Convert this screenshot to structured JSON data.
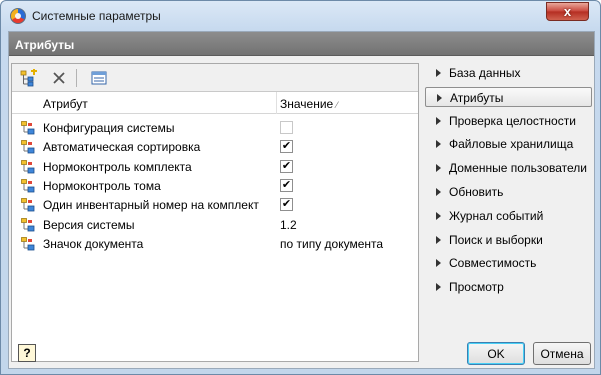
{
  "window": {
    "title": "Системные параметры",
    "close_glyph": "x"
  },
  "header": {
    "title": "Атрибуты"
  },
  "toolbar": {
    "buttons": [
      {
        "name": "add-attribute-icon"
      },
      {
        "name": "delete-icon"
      },
      {
        "name": "properties-icon"
      }
    ]
  },
  "grid": {
    "columns": {
      "attribute": "Атрибут",
      "value": "Значение"
    },
    "rows": [
      {
        "label": "Конфигурация системы",
        "type": "checkbox",
        "checked": false,
        "value": ""
      },
      {
        "label": "Автоматическая сортировка",
        "type": "checkbox",
        "checked": true,
        "value": ""
      },
      {
        "label": "Нормоконтроль комплекта",
        "type": "checkbox",
        "checked": true,
        "value": ""
      },
      {
        "label": "Нормоконтроль тома",
        "type": "checkbox",
        "checked": true,
        "value": ""
      },
      {
        "label": "Один инвентарный номер на комплект",
        "type": "checkbox",
        "checked": true,
        "value": ""
      },
      {
        "label": "Версия системы",
        "type": "text",
        "checked": false,
        "value": "1.2"
      },
      {
        "label": "Значок документа",
        "type": "text",
        "checked": false,
        "value": "по типу документа"
      }
    ]
  },
  "nav": {
    "items": [
      {
        "label": "База данных",
        "active": false
      },
      {
        "label": "Атрибуты",
        "active": true
      },
      {
        "label": "Проверка целостности",
        "active": false
      },
      {
        "label": "Файловые хранилища",
        "active": false
      },
      {
        "label": "Доменные пользователи",
        "active": false
      },
      {
        "label": "Обновить",
        "active": false
      },
      {
        "label": "Журнал событий",
        "active": false
      },
      {
        "label": "Поиск и выборки",
        "active": false
      },
      {
        "label": "Совместимость",
        "active": false
      },
      {
        "label": "Просмотр",
        "active": false
      }
    ]
  },
  "footer": {
    "ok_label": "OK",
    "cancel_label": "Отмена",
    "help_glyph": "?"
  },
  "colors": {
    "header_bg": "#808080",
    "window_frame": "#c6d9ee",
    "close_button": "#c8453a"
  }
}
